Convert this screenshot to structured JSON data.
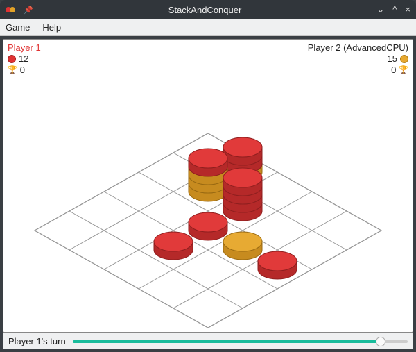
{
  "window": {
    "title": "StackAndConquer",
    "controls": {
      "min": "⌄",
      "max": "^",
      "close": "×"
    }
  },
  "menu": {
    "items": [
      "Game",
      "Help"
    ]
  },
  "players": {
    "p1": {
      "name": "Player 1",
      "chips": "12",
      "wins": "0",
      "color": "#e03333"
    },
    "p2": {
      "name": "Player 2 (AdvancedCPU)",
      "chips": "15",
      "wins": "0",
      "color": "#e7a82f"
    }
  },
  "status": {
    "text": "Player 1's turn",
    "slider_percent": 92
  },
  "board": {
    "size": 5,
    "stacks": [
      {
        "col": 1,
        "row": 0,
        "pieces": [
          "yellow",
          "red",
          "red"
        ]
      },
      {
        "col": 1,
        "row": 1,
        "pieces": [
          "yellow",
          "yellow",
          "yellow",
          "red"
        ]
      },
      {
        "col": 2,
        "row": 1,
        "pieces": [
          "red",
          "red",
          "red",
          "red"
        ]
      },
      {
        "col": 2,
        "row": 2,
        "pieces": [
          "red"
        ]
      },
      {
        "col": 3,
        "row": 2,
        "pieces": [
          "yellow"
        ]
      },
      {
        "col": 4,
        "row": 2,
        "pieces": [
          "red"
        ]
      },
      {
        "col": 2,
        "row": 3,
        "pieces": [
          "red"
        ]
      }
    ]
  }
}
